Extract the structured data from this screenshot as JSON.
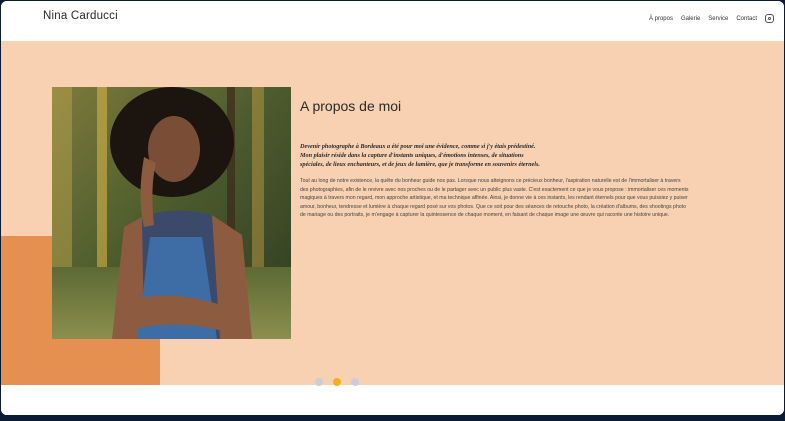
{
  "header": {
    "brand": "Nina Carducci",
    "nav": [
      "À propos",
      "Galerie",
      "Service",
      "Contact"
    ],
    "social_icon": "instagram-icon"
  },
  "about": {
    "title": "A propos de moi",
    "lead": [
      "Devenir photographe à Bordeaux a été pour moi une évidence, comme si j'y étais prédestiné.",
      "Mon plaisir réside dans la capture d'instants uniques, d'émotions intenses, de situations",
      "spéciales, de lieux enchanteurs, et de jeux de lumière, que je transforme en souvenirs éternels."
    ],
    "body": "Tout au long de notre existence, la quête du bonheur guide nos pas. Lorsque nous atteignons ce précieux bonheur, l'aspiration naturelle est de l'immortaliser à travers des photographies, afin de le revivre avec nos proches ou de le partager avec un public plus vaste. C'est exactement ce que je vous propose : immortaliser ces moments magiques à travers mon regard, mon approche artistique, et ma technique affinée. Ainsi, je donne vie à ces instants, les rendant éternels pour que vous puissiez y puiser amour, bonheur, tendresse et lumière à chaque regard posé sur vos photos. Que ce soit pour des séances de retouche photo, la création d'albums, des shootings photo de mariage ou des portraits, je m'engage à capturer la quintessence de chaque moment, en faisant de chaque image une œuvre qui raconte une histoire unique."
  },
  "carousel": {
    "count": 3,
    "active_index": 1
  },
  "colors": {
    "section_bg": "#f7d1b1",
    "accent_block": "#e58f50",
    "dot_active": "#f2b11b",
    "dot_inactive": "#c8cfd8"
  }
}
